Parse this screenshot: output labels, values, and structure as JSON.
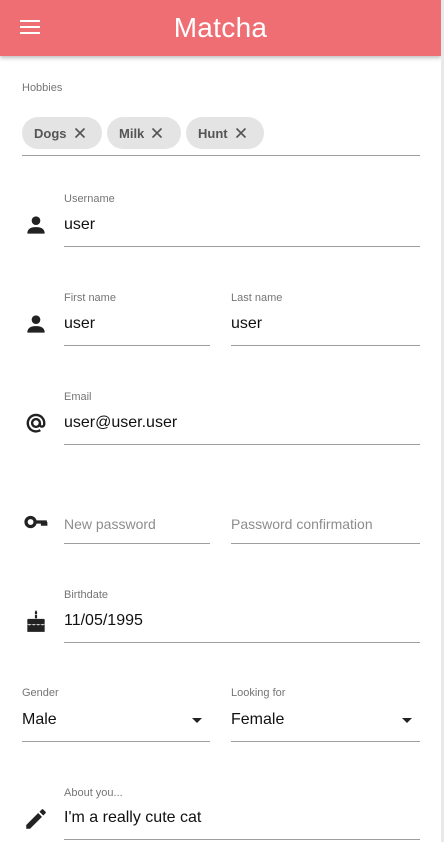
{
  "app": {
    "title": "Matcha"
  },
  "hobbies": {
    "label": "Hobbies",
    "chips": [
      {
        "label": "Dogs"
      },
      {
        "label": "Milk"
      },
      {
        "label": "Hunt"
      }
    ]
  },
  "username": {
    "label": "Username",
    "value": "user",
    "icon": "person-icon"
  },
  "first_name": {
    "label": "First name",
    "value": "user",
    "icon": "person-icon"
  },
  "last_name": {
    "label": "Last name",
    "value": "user"
  },
  "email": {
    "label": "Email",
    "value": "user@user.user",
    "icon": "at-sign-icon"
  },
  "new_password": {
    "placeholder": "New password",
    "icon": "key-icon"
  },
  "password_confirmation": {
    "placeholder": "Password confirmation"
  },
  "birthdate": {
    "label": "Birthdate",
    "value": "11/05/1995",
    "icon": "cake-icon"
  },
  "gender": {
    "label": "Gender",
    "value": "Male"
  },
  "looking_for": {
    "label": "Looking for",
    "value": "Female"
  },
  "about": {
    "label": "About you...",
    "value": "I'm a really cute cat",
    "icon": "pencil-icon"
  },
  "colors": {
    "appbar": "#ee6e73",
    "chip_bg": "#e4e4e4"
  }
}
